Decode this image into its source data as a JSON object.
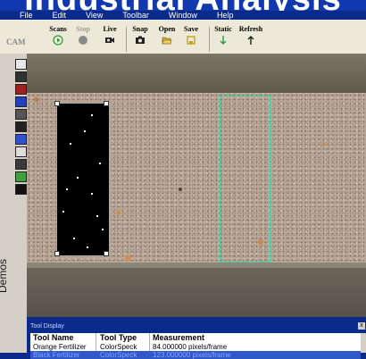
{
  "slide": {
    "title": "Industrial Analysis"
  },
  "menubar": {
    "items": [
      "File",
      "Edit",
      "View",
      "Toolbar",
      "Window",
      "Help"
    ]
  },
  "toolbar": {
    "section_label": "CAM",
    "buttons": [
      {
        "label": "Scans",
        "icon": "play-circle-icon",
        "color": "#2e9e3a",
        "disabled": false
      },
      {
        "label": "Stop",
        "icon": "stop-circle-icon",
        "color": "#7a7a7a",
        "disabled": true
      },
      {
        "label": "Live",
        "icon": "camera-icon",
        "color": "#000000",
        "disabled": false
      },
      {
        "label": "Snap",
        "icon": "snapshot-icon",
        "color": "#000000",
        "disabled": false
      },
      {
        "label": "Open",
        "icon": "folder-open-icon",
        "color": "#c8a020",
        "disabled": false
      },
      {
        "label": "Save",
        "icon": "save-icon",
        "color": "#c8a020",
        "disabled": false
      },
      {
        "label": "Static",
        "icon": "arrow-down-icon",
        "color": "#2e9e3a",
        "disabled": false
      },
      {
        "label": "Refresh",
        "icon": "arrow-up-icon",
        "color": "#000000",
        "disabled": false
      }
    ]
  },
  "side_panel": {
    "label": "Demos"
  },
  "tool_display": {
    "title": "Tool Display",
    "close_label": "x",
    "columns": [
      "Tool Name",
      "Tool Type",
      "Measurement"
    ],
    "rows": [
      [
        "Orange Fertilizer",
        "ColorSpeck",
        "84.000000 pixels/frame"
      ],
      [
        "Black Fertilizer",
        "ColorSpeck",
        "123.000000 pixels/frame"
      ]
    ],
    "selected_row": 1
  },
  "colors": {
    "slide_background": "#0a2a8c",
    "roi_outline": "#3fd0a8",
    "selection": "#3058c8"
  }
}
